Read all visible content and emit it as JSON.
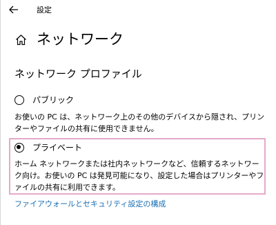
{
  "window": {
    "title": "設定"
  },
  "header": {
    "title": "ネットワーク"
  },
  "section": {
    "title": "ネットワーク プロファイル"
  },
  "profiles": [
    {
      "label": "パブリック",
      "selected": false,
      "description": "お使いの PC は、ネットワーク上のその他のデバイスから隠され、プリンターやファイルの共有に使用できません。"
    },
    {
      "label": "プライベート",
      "selected": true,
      "description": "ホーム ネットワークまたは社内ネットワークなど、信頼するネットワーク向け。お使いの PC は発見可能になり、設定した場合はプリンターやファイルの共有に利用できます。"
    }
  ],
  "link": {
    "label": "ファイアウォールとセキュリティ設定の構成"
  },
  "colors": {
    "link": "#1a6fb3",
    "highlight_border": "#e6a9c8"
  },
  "icons": {
    "back": "back-arrow-icon",
    "home": "home-icon"
  }
}
